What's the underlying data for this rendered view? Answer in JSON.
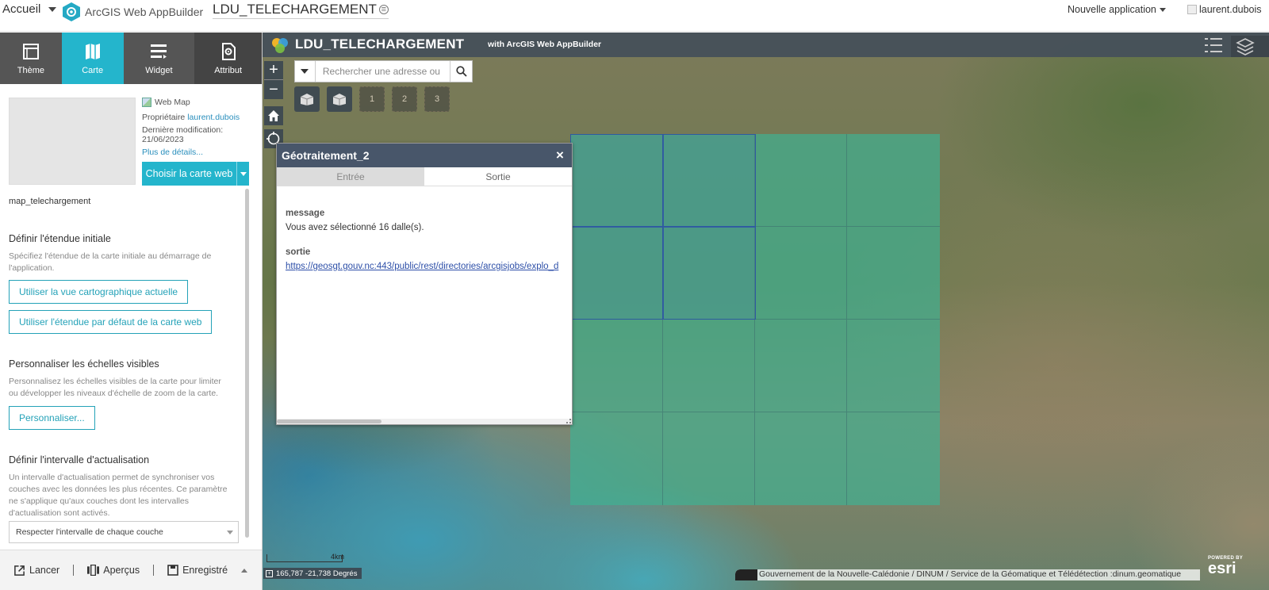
{
  "topbar": {
    "home_label": "Accueil",
    "product_name": "ArcGIS Web AppBuilder",
    "app_title": "LDU_TELECHARGEMENT",
    "new_app_label": "Nouvelle application",
    "username": "laurent.dubois"
  },
  "sidebar": {
    "tabs": [
      {
        "label": "Thème",
        "icon": "theme-icon"
      },
      {
        "label": "Carte",
        "icon": "map-icon",
        "active": true
      },
      {
        "label": "Widget",
        "icon": "widget-icon"
      },
      {
        "label": "Attribut",
        "icon": "attribute-icon"
      }
    ],
    "webmap": {
      "type_label": "Web Map",
      "owner_label": "Propriétaire",
      "owner_name": "laurent.dubois",
      "modified_label": "Dernière modification:",
      "modified_date": "21/06/2023",
      "details_link": "Plus de détails...",
      "choose_button": "Choisir la carte web",
      "map_name": "map_telechargement"
    },
    "sections": {
      "extent_title": "Définir l'étendue initiale",
      "extent_desc": "Spécifiez l'étendue de la carte initiale au démarrage de l'application.",
      "extent_btn_current": "Utiliser la vue cartographique actuelle",
      "extent_btn_default": "Utiliser l'étendue par défaut de la carte web",
      "scales_title": "Personnaliser les échelles visibles",
      "scales_desc": "Personnalisez les échelles visibles de la carte pour limiter ou développer les niveaux d'échelle de zoom de la carte.",
      "scales_btn": "Personnaliser...",
      "refresh_title": "Définir l'intervalle d'actualisation",
      "refresh_desc": "Un intervalle d'actualisation permet de synchroniser vos couches avec les données les plus récentes. Ce paramètre ne s'applique qu'aux couches dont les intervalles d'actualisation sont activés.",
      "refresh_select_value": "Respecter l'intervalle de chaque couche"
    },
    "footer": {
      "launch": "Lancer",
      "previews": "Aperçus",
      "saved": "Enregistré"
    }
  },
  "map": {
    "header_title": "LDU_TELECHARGEMENT",
    "header_subtitle": "with ArcGIS Web AppBuilder",
    "search_placeholder": "Rechercher une adresse ou",
    "placeholder_widgets": [
      "1",
      "2",
      "3"
    ],
    "scale_label": "4km",
    "coordinates": "165,787 -21,738 Degrés",
    "attribution": "Gouvernement de la Nouvelle-Calédonie / DINUM / Service de la Géomatique et Télédétection :dinum.geomatique",
    "esri_powered": "POWERED BY",
    "esri_logo": "esri",
    "tile_grid": {
      "rows": 4,
      "cols": 4,
      "selected_count": 4
    },
    "colors": {
      "grid_fill": "#3eb294",
      "selection_outline": "#2f5aa0",
      "accent": "#24b5cc"
    }
  },
  "dialog": {
    "title": "Géotraitement_2",
    "tab_input": "Entrée",
    "tab_output": "Sortie",
    "message_label": "message",
    "message_value": "Vous avez sélectionné 16 dalle(s).",
    "output_label": "sortie",
    "output_link": "https://geosgt.gouv.nc:443/public/rest/directories/arcgisjobs/explo_d"
  }
}
